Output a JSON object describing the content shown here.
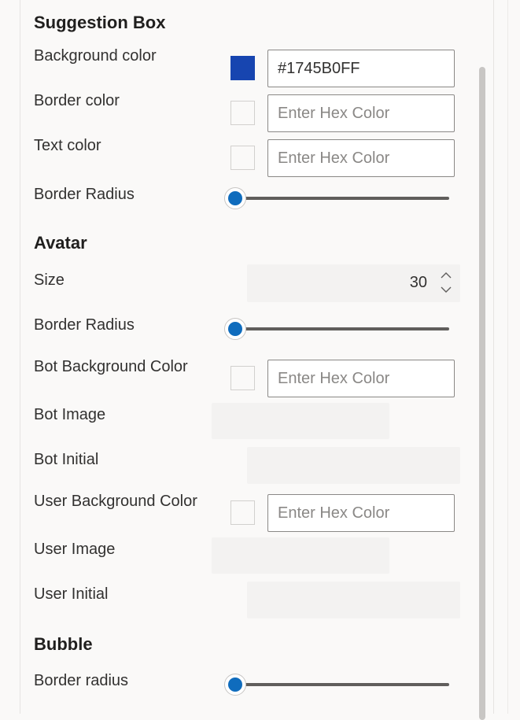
{
  "suggestion_box": {
    "title": "Suggestion Box",
    "background_color_label": "Background color",
    "background_color_value": "#1745B0FF",
    "background_swatch_color": "#1745B0",
    "border_color_label": "Border color",
    "border_color_placeholder": "Enter Hex Color",
    "text_color_label": "Text color",
    "text_color_placeholder": "Enter Hex Color",
    "border_radius_label": "Border Radius",
    "border_radius_value": 0
  },
  "avatar": {
    "title": "Avatar",
    "size_label": "Size",
    "size_value": "30",
    "border_radius_label": "Border Radius",
    "border_radius_value": 0,
    "bot_background_color_label": "Bot Background Color",
    "bot_background_color_placeholder": "Enter Hex Color",
    "bot_image_label": "Bot Image",
    "bot_initial_label": "Bot Initial",
    "user_background_color_label": "User Background Color",
    "user_background_color_placeholder": "Enter Hex Color",
    "user_image_label": "User Image",
    "user_initial_label": "User Initial"
  },
  "bubble": {
    "title": "Bubble",
    "border_radius_label": "Border radius",
    "border_radius_value": 0
  },
  "colors": {
    "slider_accent": "#0f6cbd",
    "input_border": "#8a8886",
    "panel_background": "#faf9f8"
  }
}
